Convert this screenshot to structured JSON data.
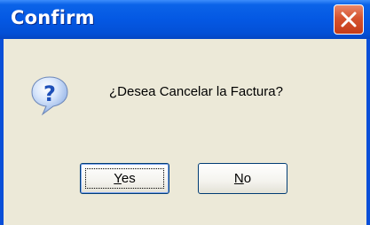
{
  "dialog": {
    "title": "Confirm",
    "message": "¿Desea Cancelar la Factura?",
    "icon": "question-icon",
    "close_icon": "close-icon",
    "buttons": {
      "yes": {
        "accel": "Y",
        "rest": "es"
      },
      "no": {
        "accel": "N",
        "rest": "o"
      }
    }
  },
  "colors": {
    "titlebar": "#0458e3",
    "close_button": "#d5532f",
    "client_background": "#ece9d8",
    "icon_fill": "#2f6fd8"
  }
}
